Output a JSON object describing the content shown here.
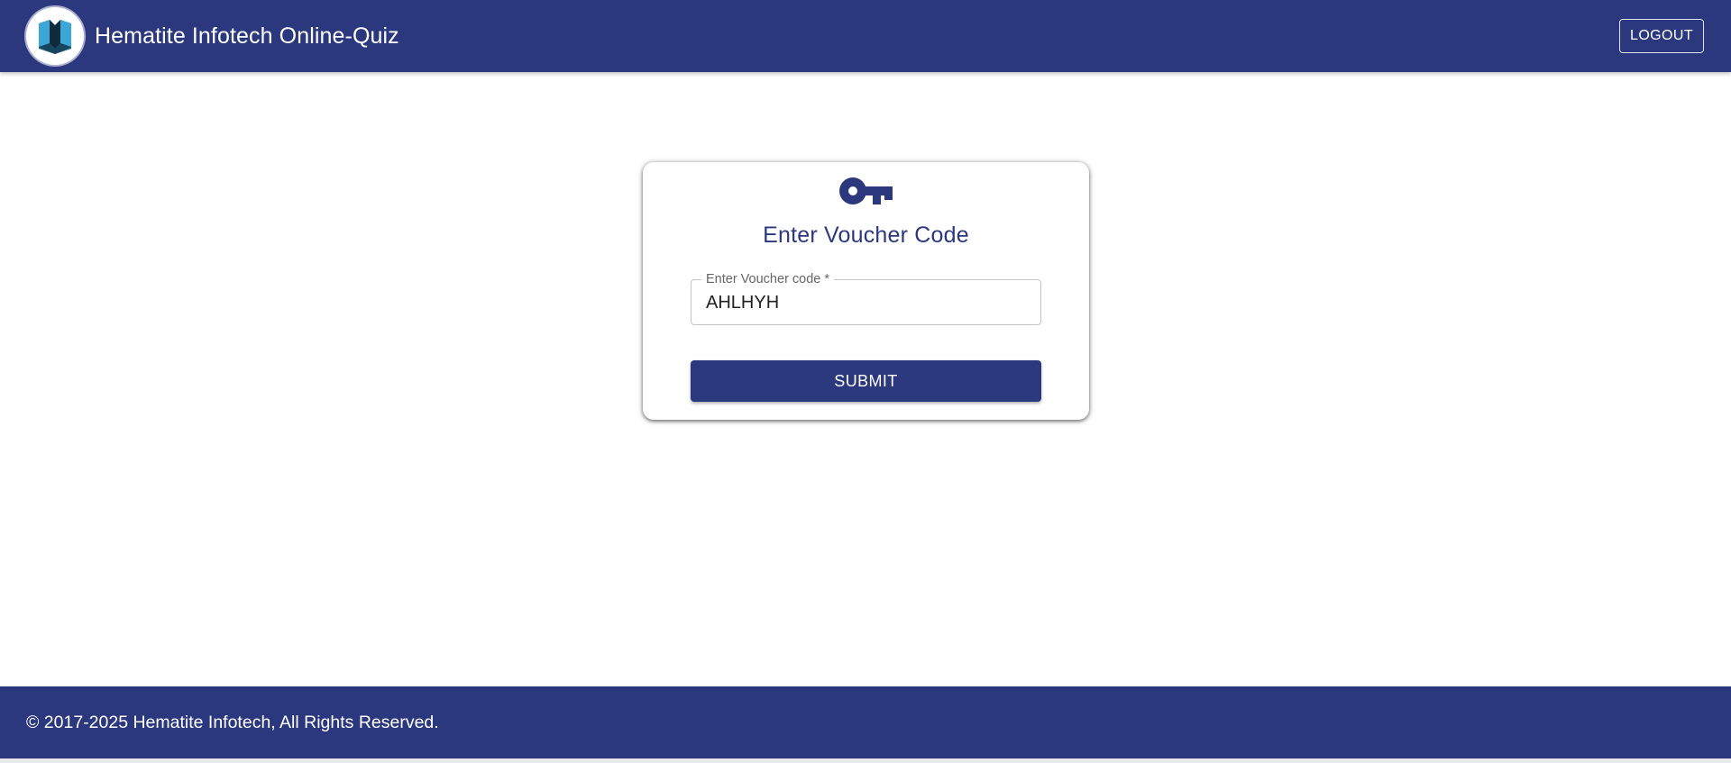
{
  "header": {
    "logo_icon": "hematite-logo-icon",
    "title": "Hematite Infotech Online-Quiz",
    "logout_label": "LOGOUT"
  },
  "voucher_card": {
    "icon": "key-icon",
    "title": "Enter Voucher Code",
    "field_label": "Enter Voucher code *",
    "field_value": "AHLHYH",
    "submit_label": "SUBMIT"
  },
  "footer": {
    "copyright": "© 2017-2025 Hematite Infotech, All Rights Reserved."
  },
  "colors": {
    "primary": "#2c387e",
    "background": "#ffffff",
    "field_border": "#c4c4c4"
  }
}
